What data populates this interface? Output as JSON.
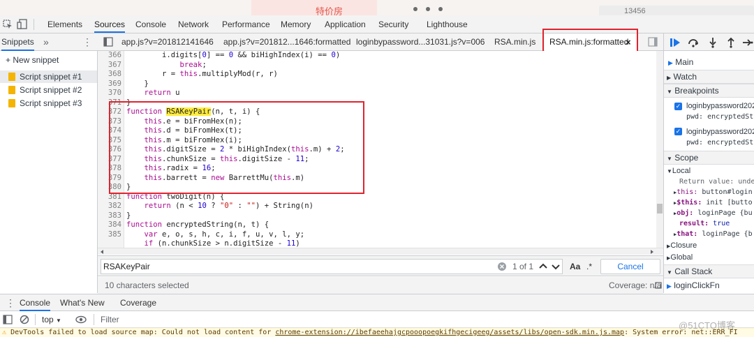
{
  "page_strip": {
    "banner_text": "特价房",
    "search_value": "13456"
  },
  "toolbar": {
    "tabs": [
      "Elements",
      "Sources",
      "Console",
      "Network",
      "Performance",
      "Memory",
      "Application",
      "Security",
      "Lighthouse"
    ],
    "active": "Sources"
  },
  "sidebar": {
    "tab_label": "Snippets",
    "more": "»",
    "menu": "⋮",
    "new_snippet": "+ New snippet",
    "items": [
      "Script snippet #1",
      "Script snippet #2",
      "Script snippet #3"
    ]
  },
  "editor": {
    "tabs": [
      "app.js?v=201812141646",
      "app.js?v=201812...1646:formatted",
      "loginbypassword...31031.js?v=006",
      "RSA.min.js",
      "RSA.min.js:formatted"
    ],
    "active_tab": "RSA.min.js:formatted",
    "close_glyph": "×",
    "line_numbers": [
      "366",
      "367",
      "368",
      "369",
      "370",
      "371",
      "372",
      "373",
      "374",
      "375",
      "376",
      "377",
      "378",
      "379",
      "380",
      "381",
      "382",
      "383",
      "384",
      "385"
    ],
    "highlight": "RSAKeyPair"
  },
  "search": {
    "value": "RSAKeyPair",
    "match_count": "1 of 1",
    "case_label": "Aa",
    "regex_label": ".*",
    "cancel": "Cancel"
  },
  "status": {
    "selected": "10 characters selected",
    "coverage": "Coverage: n/a"
  },
  "debugger": {
    "sections": {
      "main": "Main",
      "watch": "Watch",
      "breakpoints": "Breakpoints",
      "scope": "Scope",
      "local": "Local",
      "closure": "Closure",
      "global": "Global",
      "call_stack": "Call Stack"
    },
    "breakpoints": [
      {
        "file": "loginbypassword202",
        "code": "pwd: encryptedSt"
      },
      {
        "file": "loginbypassword202",
        "code": "pwd: encryptedSt"
      }
    ],
    "scope_lines": [
      {
        "key": "Return value: ",
        "val": "unde"
      },
      {
        "key": "this: ",
        "val": "button#login"
      },
      {
        "key": "$this: ",
        "val": "init [butto"
      },
      {
        "key": "obj: ",
        "val": "loginPage {bu"
      },
      {
        "key": "result: ",
        "val": "true"
      },
      {
        "key": "that: ",
        "val": "loginPage {b"
      }
    ],
    "call_stack_top": "loginClickFn"
  },
  "drawer": {
    "tabs": [
      "Console",
      "What's New",
      "Coverage"
    ],
    "active": "Console",
    "context": "top",
    "filter_placeholder": "Filter"
  },
  "warning": {
    "prefix": "DevTools failed to load source map: Could not load content for ",
    "url": "chrome-extension://ibefaeehajgcpooopoegkifhgecigeeg/assets/libs/open-sdk.min.js.map",
    "suffix": ": System error: net::ERR_FI"
  },
  "watermark": "@51CTO博客",
  "colors": {
    "accent": "#1a73e8",
    "annotation": "#e0232e",
    "highlight": "#ffec3d"
  }
}
